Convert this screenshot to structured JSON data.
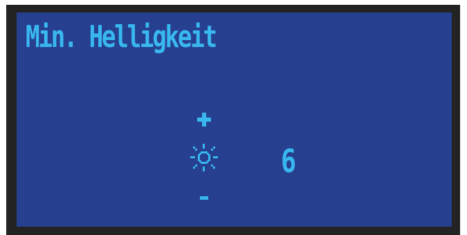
{
  "screen": {
    "title": "Min. Helligkeit",
    "value": "6"
  },
  "controls": {
    "increase_icon": "plus-icon",
    "decrease_icon": "minus-icon",
    "brightness_icon": "sun-icon"
  },
  "colors": {
    "bezel": "#232323",
    "screen_background": "#263f8f",
    "lcd_foreground": "#39b8f0"
  }
}
